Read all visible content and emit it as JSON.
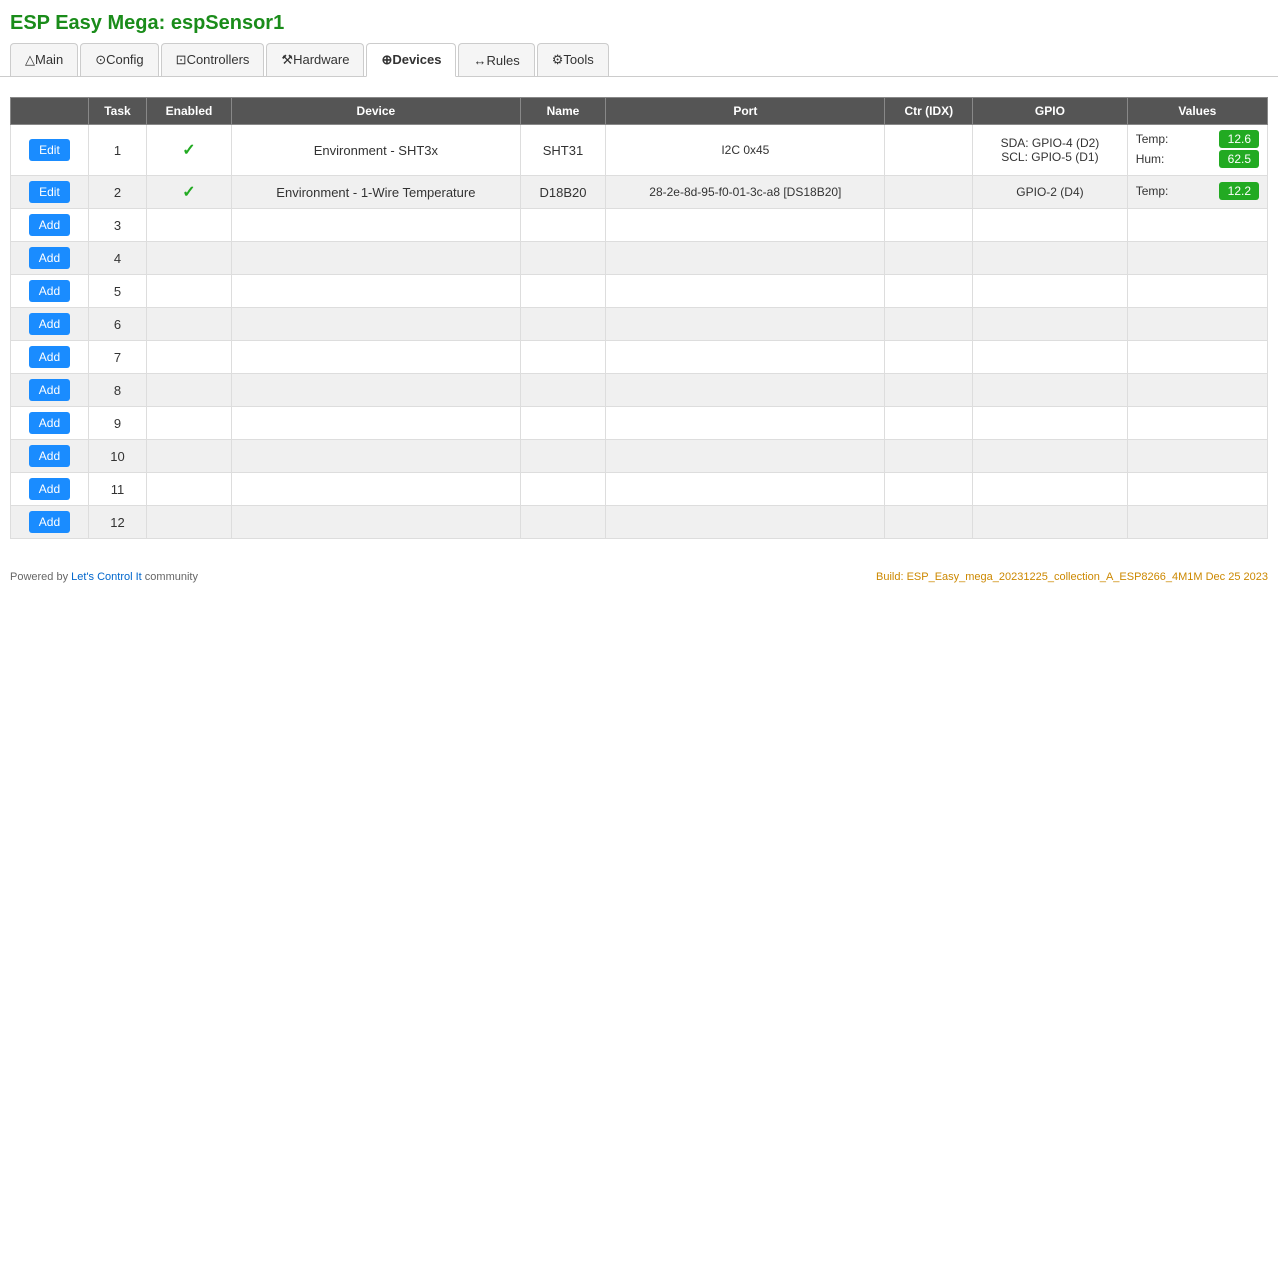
{
  "page": {
    "title": "ESP Easy Mega: espSensor1"
  },
  "nav": {
    "tabs": [
      {
        "id": "main",
        "label": "Main",
        "icon": "△",
        "active": false
      },
      {
        "id": "config",
        "label": "Config",
        "icon": "⊙",
        "active": false
      },
      {
        "id": "controllers",
        "label": "Controllers",
        "icon": "⊡",
        "active": false
      },
      {
        "id": "hardware",
        "label": "Hardware",
        "icon": "⚒",
        "active": false
      },
      {
        "id": "devices",
        "label": "Devices",
        "icon": "⊕",
        "active": true
      },
      {
        "id": "rules",
        "label": "Rules",
        "icon": "↔",
        "active": false
      },
      {
        "id": "tools",
        "label": "Tools",
        "icon": "⚙",
        "active": false
      }
    ]
  },
  "table": {
    "headers": [
      "",
      "Task",
      "Enabled",
      "Device",
      "Name",
      "Port",
      "Ctr (IDX)",
      "GPIO",
      "Values"
    ],
    "rows": [
      {
        "task": 1,
        "enabled": true,
        "device": "Environment - SHT3x",
        "name": "SHT31",
        "port": "I2C 0x45",
        "ctr_idx": "",
        "gpio": "SDA: GPIO-4 (D2)\nSCL: GPIO-5 (D1)",
        "values": [
          {
            "label": "Temp:",
            "value": "12.6"
          },
          {
            "label": "Hum:",
            "value": "62.5"
          }
        ],
        "action": "Edit"
      },
      {
        "task": 2,
        "enabled": true,
        "device": "Environment - 1-Wire Temperature",
        "name": "D18B20",
        "port": "28-2e-8d-95-f0-01-3c-a8 [DS18B20]",
        "ctr_idx": "",
        "gpio": "GPIO-2 (D4)",
        "values": [
          {
            "label": "Temp:",
            "value": "12.2"
          }
        ],
        "action": "Edit"
      },
      {
        "task": 3,
        "enabled": false,
        "device": "",
        "name": "",
        "port": "",
        "ctr_idx": "",
        "gpio": "",
        "values": [],
        "action": "Add"
      },
      {
        "task": 4,
        "enabled": false,
        "device": "",
        "name": "",
        "port": "",
        "ctr_idx": "",
        "gpio": "",
        "values": [],
        "action": "Add"
      },
      {
        "task": 5,
        "enabled": false,
        "device": "",
        "name": "",
        "port": "",
        "ctr_idx": "",
        "gpio": "",
        "values": [],
        "action": "Add"
      },
      {
        "task": 6,
        "enabled": false,
        "device": "",
        "name": "",
        "port": "",
        "ctr_idx": "",
        "gpio": "",
        "values": [],
        "action": "Add"
      },
      {
        "task": 7,
        "enabled": false,
        "device": "",
        "name": "",
        "port": "",
        "ctr_idx": "",
        "gpio": "",
        "values": [],
        "action": "Add"
      },
      {
        "task": 8,
        "enabled": false,
        "device": "",
        "name": "",
        "port": "",
        "ctr_idx": "",
        "gpio": "",
        "values": [],
        "action": "Add"
      },
      {
        "task": 9,
        "enabled": false,
        "device": "",
        "name": "",
        "port": "",
        "ctr_idx": "",
        "gpio": "",
        "values": [],
        "action": "Add"
      },
      {
        "task": 10,
        "enabled": false,
        "device": "",
        "name": "",
        "port": "",
        "ctr_idx": "",
        "gpio": "",
        "values": [],
        "action": "Add"
      },
      {
        "task": 11,
        "enabled": false,
        "device": "",
        "name": "",
        "port": "",
        "ctr_idx": "",
        "gpio": "",
        "values": [],
        "action": "Add"
      },
      {
        "task": 12,
        "enabled": false,
        "device": "",
        "name": "",
        "port": "",
        "ctr_idx": "",
        "gpio": "",
        "values": [],
        "action": "Add"
      }
    ]
  },
  "footer": {
    "powered_by": "Powered by ",
    "link_text": "Let's Control It",
    "community": " community",
    "build": "Build: ESP_Easy_mega_20231225_collection_A_ESP8266_4M1M Dec 25 2023"
  }
}
